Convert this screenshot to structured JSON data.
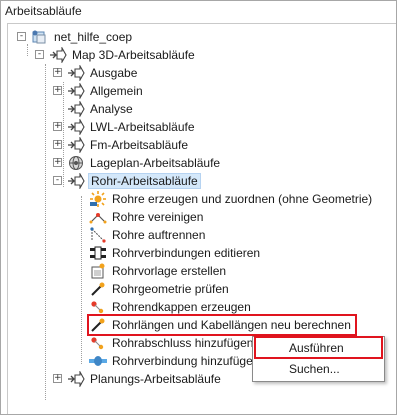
{
  "panel": {
    "title": "Arbeitsabläufe"
  },
  "tree": {
    "root": {
      "label": "net_hilfe_coep",
      "expander": "-"
    },
    "group": {
      "label": "Map 3D-Arbeitsabläufe",
      "expander": "-"
    },
    "folders": [
      {
        "label": "Ausgabe",
        "expander": "+"
      },
      {
        "label": "Allgemein",
        "expander": "+"
      },
      {
        "label": "Analyse",
        "expander": ""
      },
      {
        "label": "LWL-Arbeitsabläufe",
        "expander": "+"
      },
      {
        "label": "Fm-Arbeitsabläufe",
        "expander": "+"
      },
      {
        "label": "Lageplan-Arbeitsabläufe",
        "expander": "+"
      }
    ],
    "selected": {
      "label": "Rohr-Arbeitsabläufe",
      "expander": "-"
    },
    "children": [
      {
        "label": "Rohre erzeugen und zuordnen (ohne Geometrie)",
        "icon": "sun-star-icon"
      },
      {
        "label": "Rohre vereinigen",
        "icon": "merge-pipes-icon"
      },
      {
        "label": "Rohre auftrennen",
        "icon": "split-pipes-icon"
      },
      {
        "label": "Rohrverbindungen editieren",
        "icon": "pipe-connection-icon"
      },
      {
        "label": "Rohrvorlage erstellen",
        "icon": "template-icon"
      },
      {
        "label": "Rohrgeometrie prüfen",
        "icon": "magic-wand-icon"
      },
      {
        "label": "Rohrendkappen erzeugen",
        "icon": "endcap-icon"
      },
      {
        "label": "Rohrlängen und Kabellängen neu berechnen",
        "icon": "magic-wand-icon"
      },
      {
        "label": "Rohrabschluss hinzufügen",
        "icon": "endcap-icon"
      },
      {
        "label": "Rohrverbindung hinzufügen",
        "icon": "pipe-joint-icon"
      }
    ],
    "last": {
      "label": "Planungs-Arbeitsabläufe",
      "expander": "+"
    }
  },
  "context_menu": {
    "items": [
      {
        "label": "Ausführen"
      },
      {
        "label": "Suchen..."
      }
    ]
  },
  "colors": {
    "highlight": "#e0141e",
    "selection": "#d4e8fa",
    "arrow_blue": "#3f86c6"
  }
}
